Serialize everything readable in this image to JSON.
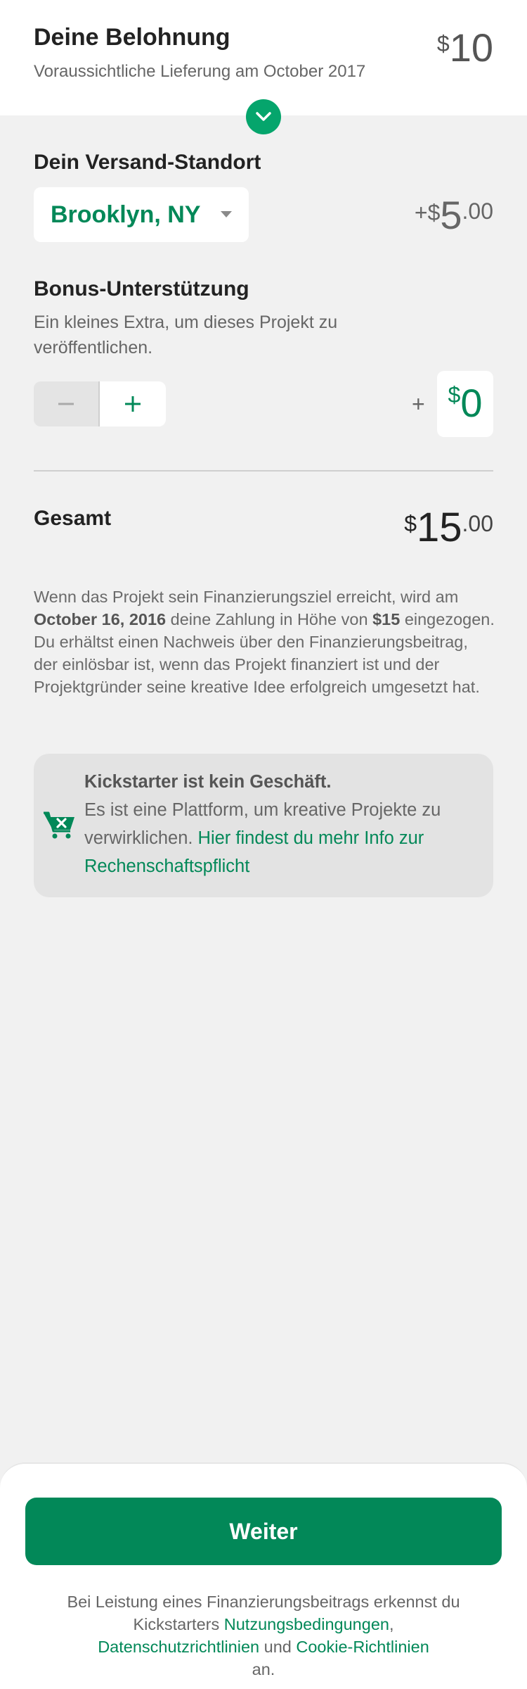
{
  "reward": {
    "title": "Deine Belohnung",
    "delivery": "Voraussichtliche Lieferung am October 2017",
    "currency": "$",
    "amount": "10",
    "expand_icon": "chevron-down-icon"
  },
  "shipping": {
    "label": "Dein Versand-Standort",
    "location": "Brooklyn, NY",
    "price_prefix": "+$",
    "price_whole": "5",
    "price_cents": ".00"
  },
  "bonus": {
    "label": "Bonus-Unterstützung",
    "description": "Ein kleines Extra, um dieses Projekt zu veröffentlichen.",
    "plus_sign": "+",
    "currency": "$",
    "amount": "0",
    "decrement_icon": "minus-icon",
    "increment_icon": "plus-icon"
  },
  "total": {
    "label": "Gesamt",
    "currency": "$",
    "whole": "15",
    "cents": ".00"
  },
  "charge_note": {
    "part1": "Wenn das Projekt sein Finanzierungsziel erreicht, wird am ",
    "date": "October 16, 2016",
    "part2": " deine Zahlung in Höhe von ",
    "amount": "$15",
    "part3": " eingezogen. Du erhältst einen Nachweis über den Finanzierungsbeitrag, der einlösbar ist, wenn das Projekt finanziert ist und der Projektgründer seine kreative Idee erfolgreich umgesetzt hat."
  },
  "info": {
    "icon": "cart-x-icon",
    "heading": "Kickstarter ist kein Geschäft.",
    "body": "Es ist eine Plattform, um kreative Projekte zu verwirklichen. ",
    "link": "Hier findest du mehr Info zur Rechenschaftspflicht"
  },
  "footer": {
    "button": "Weiter",
    "legal_part1": "Bei Leistung eines Finanzierungsbeitrags erkennst du Kickstarters ",
    "terms_link": "Nutzungsbedingungen",
    "comma": ",",
    "privacy_link": "Datenschutzrichtlinien",
    "and": " und ",
    "cookie_link": "Cookie-Richtlinien",
    "legal_end": " an."
  },
  "colors": {
    "accent": "#028858",
    "chevron_bg": "#05a56c",
    "background": "#f1f1f1"
  }
}
